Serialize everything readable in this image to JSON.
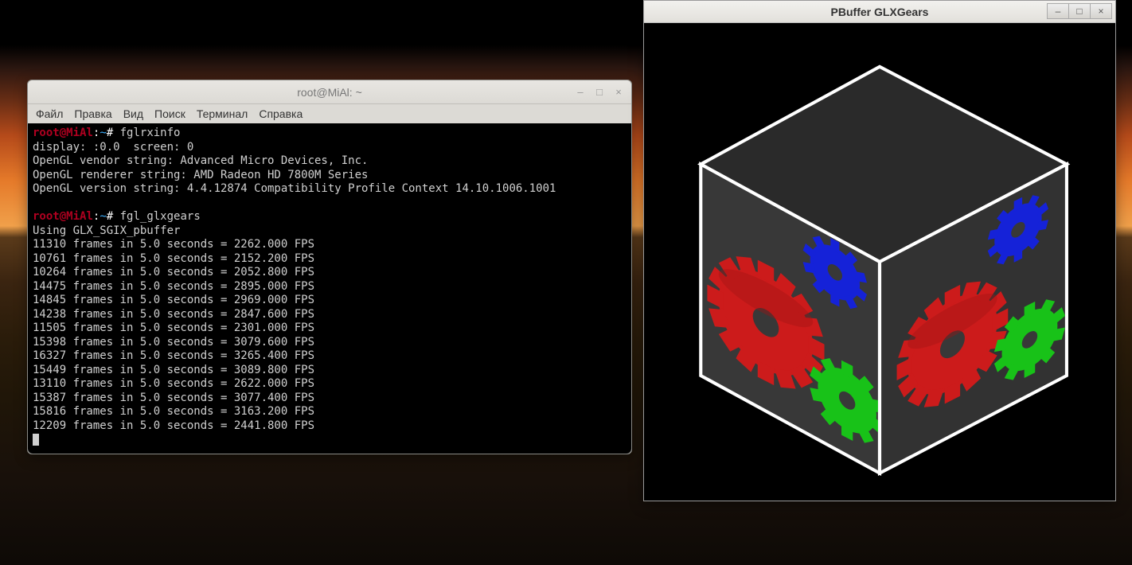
{
  "terminal": {
    "title": "root@MiAl: ~",
    "menu": [
      "Файл",
      "Правка",
      "Вид",
      "Поиск",
      "Терминал",
      "Справка"
    ],
    "prompt": {
      "user": "root",
      "at": "@",
      "host": "MiAl",
      "sep": ":",
      "path": "~",
      "end": "# "
    },
    "cmd1": "fglrxinfo",
    "out1": [
      "display: :0.0  screen: 0",
      "OpenGL vendor string: Advanced Micro Devices, Inc.",
      "OpenGL renderer string: AMD Radeon HD 7800M Series",
      "OpenGL version string: 4.4.12874 Compatibility Profile Context 14.10.1006.1001"
    ],
    "cmd2": "fgl_glxgears",
    "out2_header": "Using GLX_SGIX_pbuffer",
    "fps_lines": [
      "11310 frames in 5.0 seconds = 2262.000 FPS",
      "10761 frames in 5.0 seconds = 2152.200 FPS",
      "10264 frames in 5.0 seconds = 2052.800 FPS",
      "14475 frames in 5.0 seconds = 2895.000 FPS",
      "14845 frames in 5.0 seconds = 2969.000 FPS",
      "14238 frames in 5.0 seconds = 2847.600 FPS",
      "11505 frames in 5.0 seconds = 2301.000 FPS",
      "15398 frames in 5.0 seconds = 3079.600 FPS",
      "16327 frames in 5.0 seconds = 3265.400 FPS",
      "15449 frames in 5.0 seconds = 3089.800 FPS",
      "13110 frames in 5.0 seconds = 2622.000 FPS",
      "15387 frames in 5.0 seconds = 3077.400 FPS",
      "15816 frames in 5.0 seconds = 3163.200 FPS",
      "12209 frames in 5.0 seconds = 2441.800 FPS"
    ]
  },
  "gears": {
    "title": "PBuffer GLXGears",
    "colors": {
      "face": "#383838",
      "edge": "#ffffff",
      "red": "#cc1b1b",
      "green": "#18c218",
      "blue": "#1522d8"
    }
  }
}
